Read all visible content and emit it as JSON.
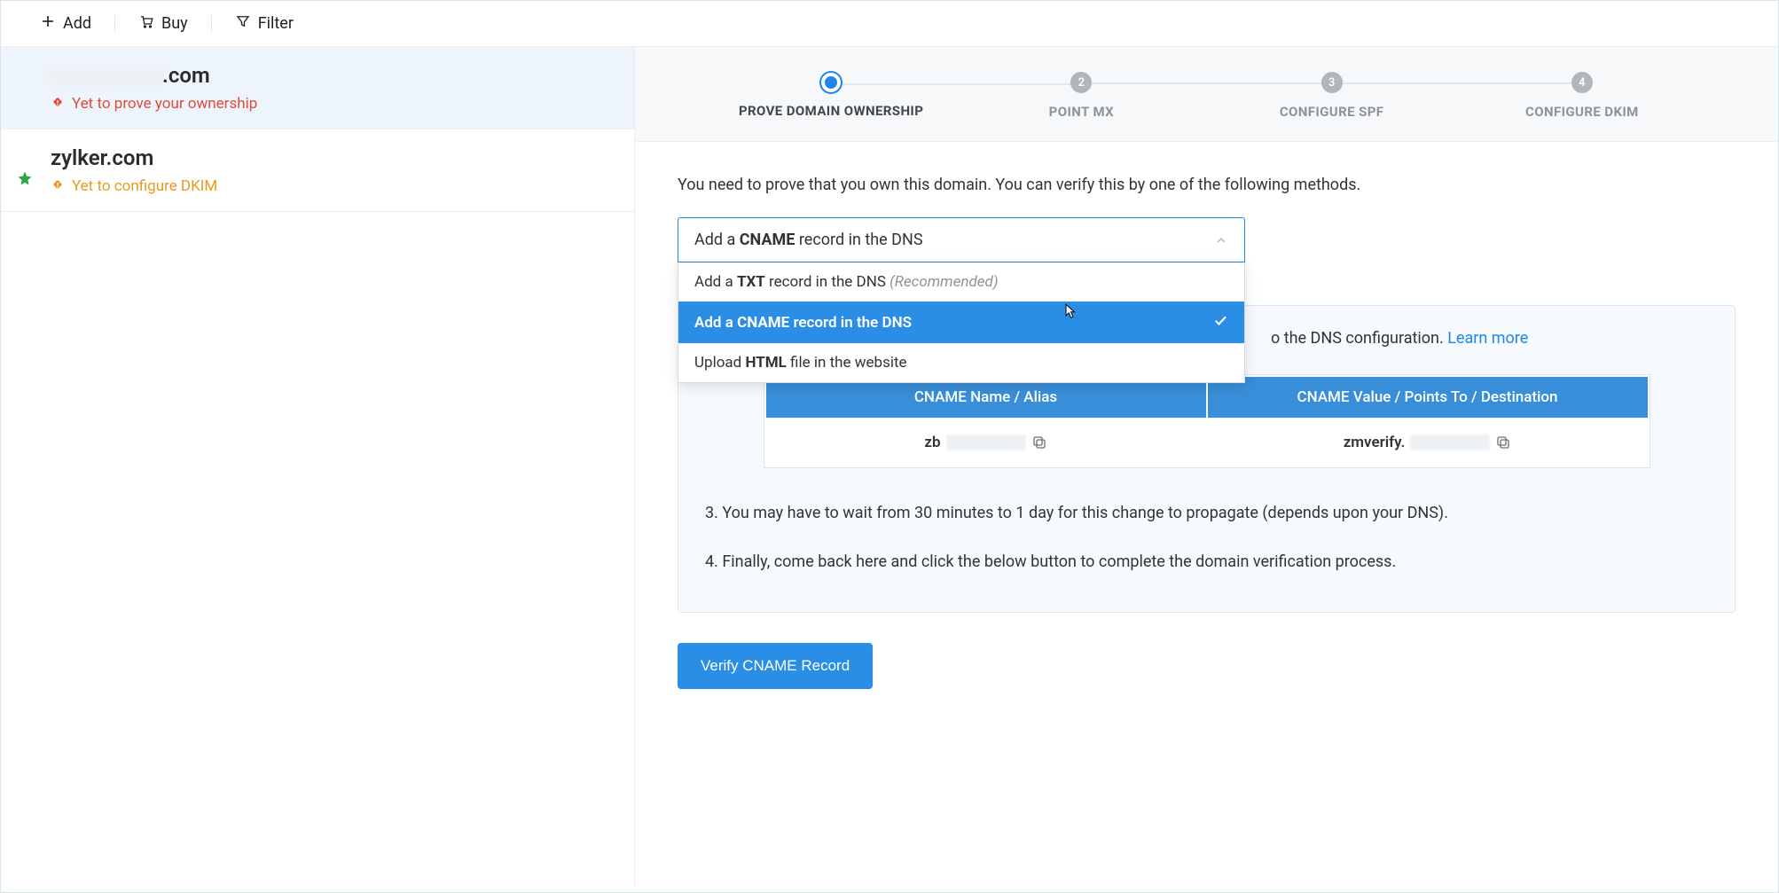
{
  "toolbar": {
    "add_label": "Add",
    "buy_label": "Buy",
    "filter_label": "Filter"
  },
  "sidebar": {
    "domains": [
      {
        "name_suffix": ".com",
        "status": "Yet to prove your ownership",
        "status_type": "red"
      },
      {
        "name": "zylker.com",
        "status": "Yet to configure DKIM",
        "status_type": "amber",
        "starred": true
      }
    ]
  },
  "stepper": {
    "steps": [
      {
        "num": "",
        "label": "PROVE DOMAIN OWNERSHIP",
        "active": true
      },
      {
        "num": "2",
        "label": "POINT MX"
      },
      {
        "num": "3",
        "label": "CONFIGURE SPF"
      },
      {
        "num": "4",
        "label": "CONFIGURE DKIM"
      }
    ]
  },
  "main": {
    "intro": "You need to prove that you own this domain. You can verify this by one of the following methods.",
    "dropdown": {
      "selected_prefix": "Add a ",
      "selected_strong": "CNAME",
      "selected_suffix": " record in the DNS",
      "options": [
        {
          "prefix": "Add a ",
          "strong": "TXT",
          "suffix": " record in the DNS ",
          "recommended": "(Recommended)"
        },
        {
          "prefix": "Add a ",
          "strong": "CNAME",
          "suffix": " record in the DNS",
          "selected": true
        },
        {
          "prefix": "Upload ",
          "strong": "HTML",
          "suffix": " file in the website"
        }
      ]
    },
    "info_partial_tail": "o the DNS configuration. ",
    "learn_more": "Learn more",
    "table": {
      "header_name": "CNAME Name / Alias",
      "header_value": "CNAME Value / Points To / Destination",
      "row_name_prefix": "zb",
      "row_value_prefix": "zmverify."
    },
    "step3": "3. You may have to wait from 30 minutes to 1 day for this change to propagate (depends upon your DNS).",
    "step4": "4. Finally, come back here and click the below button to complete the domain verification process.",
    "verify_button": "Verify CNAME Record"
  }
}
